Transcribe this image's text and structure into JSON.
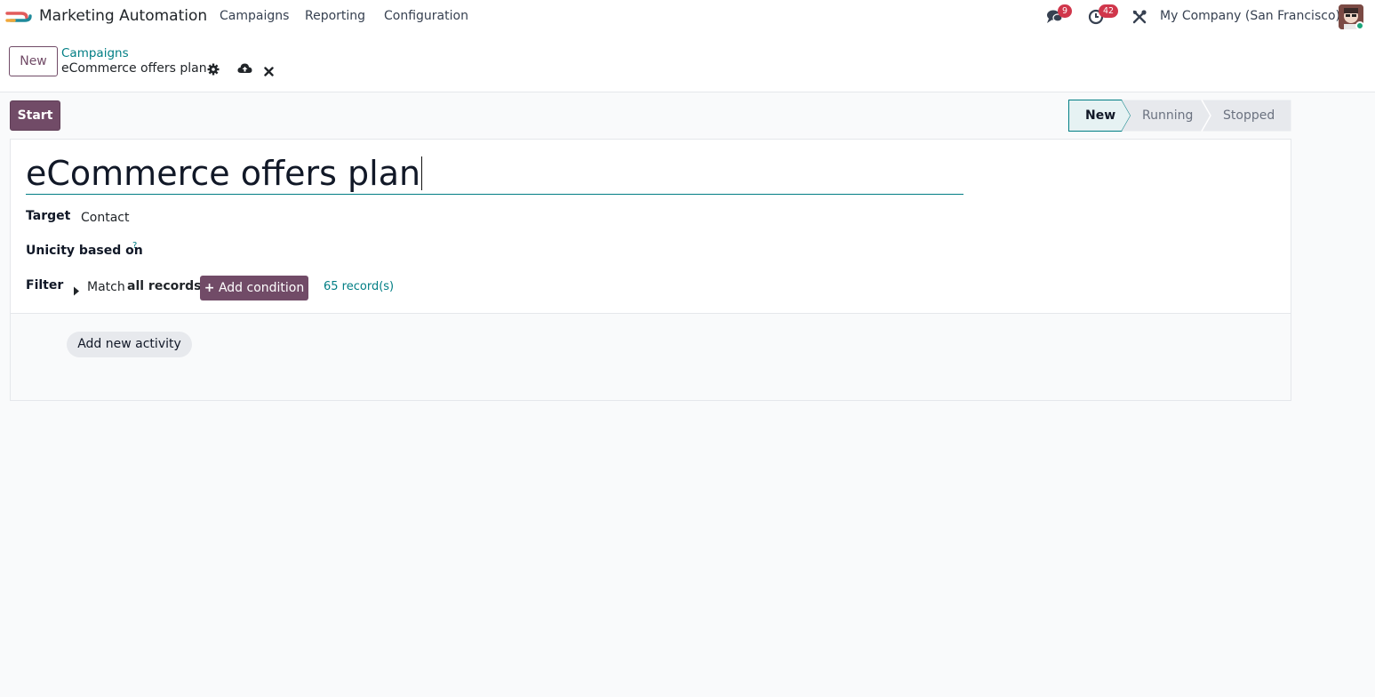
{
  "navbar": {
    "app_name": "Marketing Automation",
    "menus": [
      "Campaigns",
      "Reporting",
      "Configuration"
    ],
    "messages_count": "9",
    "activities_count": "42",
    "company": "My Company (San Francisco)"
  },
  "control_panel": {
    "new_label": "New",
    "breadcrumb_parent": "Campaigns",
    "breadcrumb_current": "eCommerce offers plan"
  },
  "header": {
    "start_label": "Start",
    "stages": [
      "New",
      "Running",
      "Stopped"
    ],
    "active_stage": "New"
  },
  "form": {
    "name": "eCommerce offers plan",
    "target_label": "Target",
    "target_value": "Contact",
    "unicity_label": "Unicity based on",
    "unicity_help": "?",
    "filter_label": "Filter",
    "match_prefix": "Match",
    "match_value": "all records",
    "add_condition_label": "Add condition",
    "records_link": "65 record(s)",
    "add_activity_label": "Add new activity"
  },
  "colors": {
    "brand": "#714b67",
    "link": "#017e84",
    "badge": "#d0364b"
  }
}
